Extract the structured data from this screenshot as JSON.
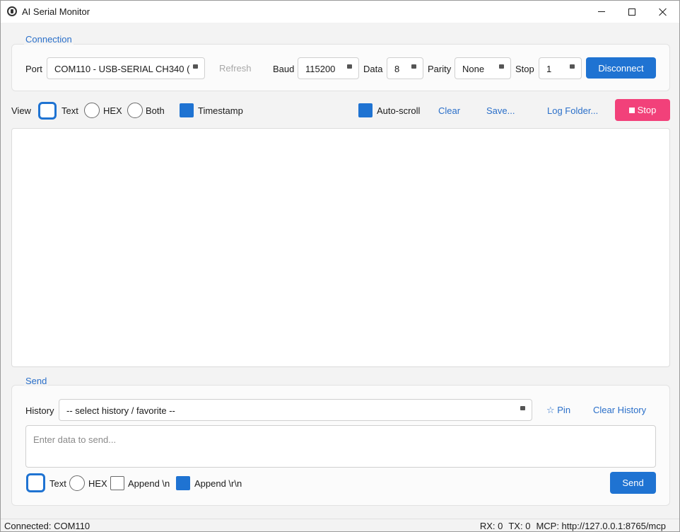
{
  "window": {
    "title": "AI Serial Monitor"
  },
  "connection": {
    "group_title": "Connection",
    "port_label": "Port",
    "port_value": "COM110 - USB-SERIAL CH340 (",
    "refresh_label": "Refresh",
    "baud_label": "Baud",
    "baud_value": "115200",
    "data_label": "Data",
    "data_value": "8",
    "parity_label": "Parity",
    "parity_value": "None",
    "stop_label": "Stop",
    "stop_value": "1",
    "disconnect_label": "Disconnect"
  },
  "view": {
    "view_label": "View",
    "text_label": "Text",
    "hex_label": "HEX",
    "both_label": "Both",
    "timestamp_label": "Timestamp",
    "autoscroll_label": "Auto-scroll",
    "clear_label": "Clear",
    "save_label": "Save...",
    "log_folder_label": "Log Folder...",
    "stop_label": "Stop",
    "selected_mode": "Text",
    "timestamp_checked": true,
    "autoscroll_checked": true
  },
  "send": {
    "group_title": "Send",
    "history_label": "History",
    "history_value": "-- select history / favorite --",
    "pin_label": "☆ Pin",
    "clear_history_label": "Clear History",
    "input_placeholder": "Enter data to send...",
    "text_label": "Text",
    "hex_label": "HEX",
    "append_n_label": "Append \\n",
    "append_rn_label": "Append \\r\\n",
    "send_button_label": "Send",
    "selected_mode": "Text",
    "append_n_checked": false,
    "append_rn_checked": true
  },
  "status": {
    "connected_text": "Connected: COM110",
    "rx_text": "RX: 0",
    "tx_text": "TX: 0",
    "mcp_text": "MCP: http://127.0.0.1:8765/mcp"
  },
  "colors": {
    "accent": "#1f73d2",
    "stop": "#f2417a",
    "link": "#2a6fc9"
  }
}
